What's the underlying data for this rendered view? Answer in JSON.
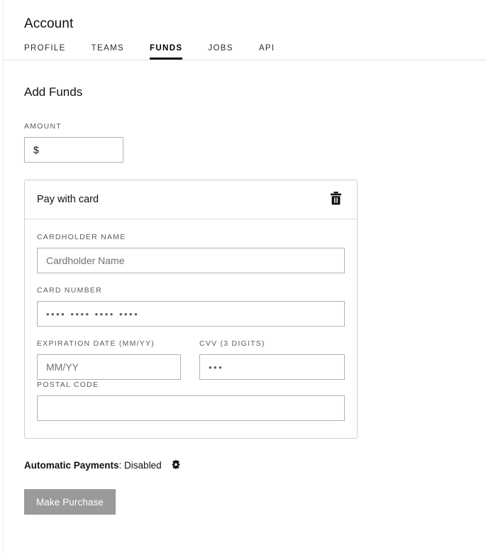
{
  "header": {
    "title": "Account",
    "tabs": [
      {
        "label": "PROFILE",
        "active": false
      },
      {
        "label": "TEAMS",
        "active": false
      },
      {
        "label": "FUNDS",
        "active": true
      },
      {
        "label": "JOBS",
        "active": false
      },
      {
        "label": "API",
        "active": false
      }
    ]
  },
  "main": {
    "section_title": "Add Funds",
    "amount": {
      "label": "AMOUNT",
      "currency_symbol": "$",
      "value": ""
    },
    "card_panel": {
      "title": "Pay with card",
      "delete_icon": "trash-icon",
      "cardholder": {
        "label": "CARDHOLDER NAME",
        "value": "",
        "placeholder": "Cardholder Name"
      },
      "card_number": {
        "label": "CARD NUMBER",
        "value": "",
        "placeholder": "•••• •••• •••• ••••"
      },
      "expiration": {
        "label": "EXPIRATION DATE  (MM/YY)",
        "value": "",
        "placeholder": "MM/YY"
      },
      "cvv": {
        "label": "CVV  (3 DIGITS)",
        "value": "",
        "placeholder": "•••"
      },
      "postal_code": {
        "label": "POSTAL CODE",
        "value": "",
        "placeholder": ""
      }
    },
    "automatic_payments": {
      "label": "Automatic Payments",
      "value": ": Disabled",
      "settings_icon": "gear-icon"
    },
    "purchase_button": {
      "label": "Make Purchase",
      "color": "#9a9a9a",
      "text_color": "#ffffff"
    }
  }
}
